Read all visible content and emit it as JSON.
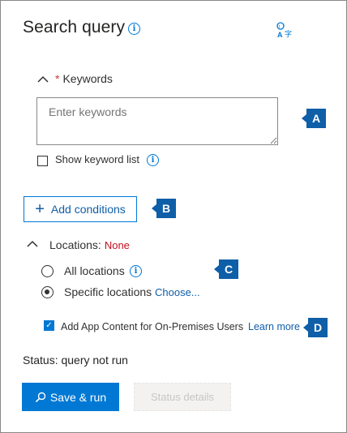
{
  "panel": {
    "title": "Search query",
    "title_info_glyph": "i",
    "translate_icon": "translate-icon"
  },
  "keywords": {
    "required_mark": "*",
    "header": "Keywords",
    "placeholder": "Enter keywords",
    "show_list_label": "Show keyword list",
    "show_list_checked": false
  },
  "conditions": {
    "add_label": "Add conditions",
    "plus_glyph": "+"
  },
  "locations": {
    "header": "Locations:",
    "value": "None",
    "options": [
      {
        "label": "All locations",
        "selected": false
      },
      {
        "label": "Specific locations",
        "selected": true
      }
    ],
    "choose_link": "Choose..."
  },
  "app_content": {
    "label": "Add App Content for On-Premises Users",
    "checked": true,
    "learn_more": "Learn more"
  },
  "status": {
    "text": "Status: query not run"
  },
  "actions": {
    "save_run": "Save & run",
    "status_details": "Status details"
  },
  "callouts": {
    "a": "A",
    "b": "B",
    "c": "C",
    "d": "D"
  },
  "colors": {
    "accent": "#0078d4",
    "callout": "#0f5ea8",
    "required": "#d13438",
    "none_value": "#c50f1f"
  }
}
